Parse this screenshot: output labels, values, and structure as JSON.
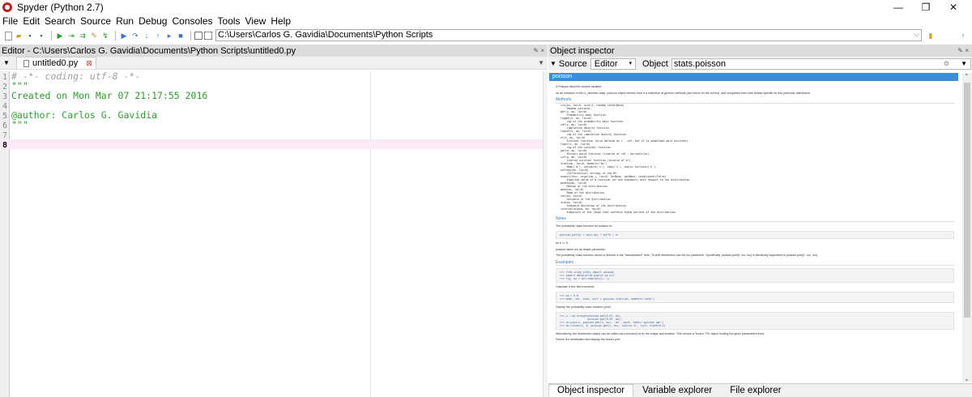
{
  "window": {
    "title": "Spyder (Python 2.7)",
    "minimize_glyph": "—",
    "restore_glyph": "❐",
    "close_glyph": "✕"
  },
  "menu": [
    "File",
    "Edit",
    "Search",
    "Source",
    "Run",
    "Debug",
    "Consoles",
    "Tools",
    "View",
    "Help"
  ],
  "toolbar": {
    "working_dir": "C:\\Users\\Carlos G. Gavidia\\Documents\\Python Scripts",
    "back_glyph": "←",
    "forward_glyph": "→"
  },
  "editor": {
    "pane_title": "Editor - C:\\Users\\Carlos G. Gavidia\\Documents\\Python Scripts\\untitled0.py",
    "tab_label": "untitled0.py",
    "current_line": 8,
    "lines": [
      {
        "n": "1",
        "text": "# -*- coding: utf-8 -*-"
      },
      {
        "n": "2",
        "text": "\"\"\""
      },
      {
        "n": "3",
        "text": "Created on Mon Mar 07 21:17:55 2016"
      },
      {
        "n": "4",
        "text": ""
      },
      {
        "n": "5",
        "text": "@author: Carlos G. Gavidia"
      },
      {
        "n": "6",
        "text": "\"\"\""
      },
      {
        "n": "7",
        "text": ""
      },
      {
        "n": "8",
        "text": ""
      }
    ]
  },
  "inspector": {
    "pane_title": "Object inspector",
    "source_label": "Source",
    "source_value": "Editor",
    "object_label": "Object",
    "object_value": "stats.poisson",
    "doc_title": "poisson",
    "doc_intro": "A Poisson discrete random variable.",
    "doc_intro2": "As an instance of the rv_discrete class, poisson object inherits from it a collection of generic methods (see below for the full list), and completes them with details specific for this particular distribution.",
    "methods_heading": "Methods",
    "methods": "rvs(mu, loc=0, size=1, random_state=None)\n    Random variates.\npmf(x, mu, loc=0)\n    Probability mass function.\nlogpmf(x, mu, loc=0)\n    Log of the probability mass function.\ncdf(x, mu, loc=0)\n    Cumulative density function.\nlogcdf(x, mu, loc=0)\n    Log of the cumulative density function.\nsf(x, mu, loc=0)\n    Survival function (also defined as 1 - cdf, but sf is sometimes more accurate).\nlogsf(x, mu, loc=0)\n    Log of the survival function.\nppf(q, mu, loc=0)\n    Percent point function (inverse of cdf — percentiles).\nisf(q, mu, loc=0)\n    Inverse survival function (inverse of sf).\nstats(mu, loc=0, moments='mv')\n    Mean('m'), variance('v'), skew('s'), and/or kurtosis('k').\nentropy(mu, loc=0)\n    (Differential) entropy of the RV.\nexpect(func, args=(mu,), loc=0, lb=None, ub=None, conditional=False)\n    Expected value of a function (of one argument) with respect to the distribution.\nmedian(mu, loc=0)\n    Median of the distribution.\nmean(mu, loc=0)\n    Mean of the distribution.\nvar(mu, loc=0)\n    Variance of the distribution.\nstd(mu, loc=0)\n    Standard deviation of the distribution.\ninterval(alpha, mu, loc=0)\n    Endpoints of the range that contains alpha percent of the distribution.",
    "notes_heading": "Notes",
    "notes1": "The probability mass function for poisson is:",
    "notes_formula": "poisson.pmf(k) = exp(-mu) * mu**k / k!",
    "notes2": "for k >= 0.",
    "notes3": "poisson takes mu as shape parameter.",
    "notes4": "The probability mass function above is defined in the \"standardized\" form. To shift distribution use the loc parameter. Specifically, poisson.pmf(k, mu, loc) is identically equivalent to poisson.pmf(k - loc, mu).",
    "examples_heading": "Examples",
    "ex1": ">>> from scipy.stats import poisson\n>>> import matplotlib.pyplot as plt\n>>> fig, ax = plt.subplots(1, 1)",
    "ex_text1": "Calculate a few first moments:",
    "ex2": ">>> mu = 0.6\n>>> mean, var, skew, kurt = poisson.stats(mu, moments='mvsk')",
    "ex_text2": "Display the probability mass function (pmf):",
    "ex3": ">>> x = np.arange(poisson.ppf(0.01, mu),\n...               poisson.ppf(0.99, mu))\n>>> ax.plot(x, poisson.pmf(x, mu), 'bo', ms=8, label='poisson pmf')\n>>> ax.vlines(x, 0, poisson.pmf(x, mu), colors='b', lw=5, alpha=0.5)",
    "ex_text3": "Alternatively, the distribution object can be called (as a function) to fix the shape and location. This returns a \"frozen\" RV object holding the given parameters fixed.",
    "ex_text4": "Freeze the distribution and display the frozen pmf:"
  },
  "bottom_tabs": [
    "Object inspector",
    "Variable explorer",
    "File explorer"
  ],
  "colors": {
    "doc_title_bg": "#3c8fd7",
    "current_line_bg": "#fbe9f7",
    "string_color": "#2ba02b",
    "comment_color": "#a0a0a0"
  }
}
